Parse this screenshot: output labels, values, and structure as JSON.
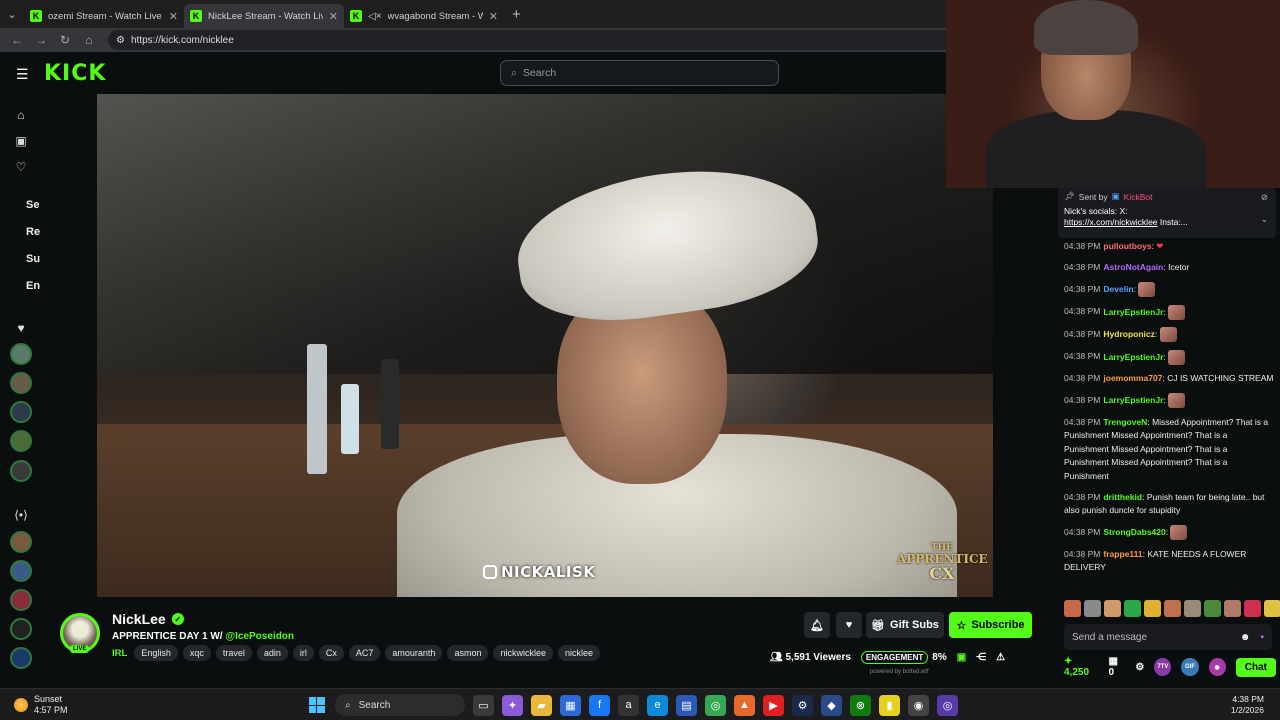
{
  "browser": {
    "tabs": [
      {
        "title": "ozemi Stream - Watch Live on Kick",
        "active": false,
        "muted": false
      },
      {
        "title": "NickLee Stream - Watch Live o",
        "active": true,
        "muted": false
      },
      {
        "title": "wvagabond Stream - Watch L",
        "active": false,
        "muted": true
      }
    ],
    "url": "https://kick.com/nicklee"
  },
  "header": {
    "logo": "KICK",
    "search_placeholder": "Search"
  },
  "rail": {
    "sections": [
      "Se",
      "Re",
      "Su",
      "En"
    ]
  },
  "video": {
    "watermark": "NICKALISK",
    "overlay_line1": "THE",
    "overlay_line2": "APPRENTICE",
    "overlay_line3": "CX"
  },
  "streamer": {
    "name": "NickLee",
    "live_label": "LIVE",
    "title_prefix": "APPRENTICE DAY 1 W/ ",
    "title_mention": "@IcePoseidon",
    "category": "IRL",
    "tags": [
      "English",
      "xqc",
      "travel",
      "adin",
      "irl",
      "Cx",
      "AC7",
      "amouranth",
      "asmon",
      "nickwicklee",
      "nicklee"
    ]
  },
  "actions": {
    "gift_subs": "Gift Subs",
    "subscribe": "Subscribe"
  },
  "stats": {
    "viewers": "5,591 Viewers",
    "engagement_label": "ENGAGEMENT",
    "engagement_value": "8%",
    "powered_by": "powered by botted.wtf"
  },
  "chat": {
    "pinned": {
      "sent_by": "Sent by",
      "bot_name": "KickBot",
      "text": "Nick's socials: X:",
      "url": "https://x.com/nickwicklee",
      "url_suffix": " Insta:..."
    },
    "messages": [
      {
        "time": "04:38 PM",
        "user": "pulloutboys",
        "color": "#ff6b6b",
        "text": "",
        "emotes": 0,
        "heart": true
      },
      {
        "time": "04:38 PM",
        "user": "AstroNotAgain",
        "color": "#b36bff",
        "text": "Icetor",
        "emotes": 0
      },
      {
        "time": "04:38 PM",
        "user": "Develin",
        "color": "#4da3ff",
        "text": "",
        "emotes": 1
      },
      {
        "time": "04:38 PM",
        "user": "LarryEpstienJr",
        "color": "#53fc18",
        "text": "",
        "emotes": 1
      },
      {
        "time": "04:38 PM",
        "user": "Hydroponicz",
        "color": "#f3e03a",
        "text": "",
        "emotes": 1
      },
      {
        "time": "04:38 PM",
        "user": "LarryEpstienJr",
        "color": "#53fc18",
        "text": "",
        "emotes": 1
      },
      {
        "time": "04:38 PM",
        "user": "joemomma707",
        "color": "#ff9a3a",
        "text": "CJ IS WATCHING STREAM",
        "emotes": 0
      },
      {
        "time": "04:38 PM",
        "user": "LarryEpstienJr",
        "color": "#53fc18",
        "text": "",
        "emotes": 1
      },
      {
        "time": "04:38 PM",
        "user": "TrengoveN",
        "color": "#53fc18",
        "text": "Missed Appointment? That is a Punishment Missed Appointment? That is a Punishment Missed Appointment? That is a Punishment Missed Appointment? That is a Punishment",
        "emotes": 0
      },
      {
        "time": "04:38 PM",
        "user": "dritthekid",
        "color": "#53fc18",
        "text": "Punish team for being late.. but also punish duncle for stupidity",
        "emotes": 0
      },
      {
        "time": "04:38 PM",
        "user": "StrongDabs420",
        "color": "#53fc18",
        "text": "",
        "emotes": 1
      },
      {
        "time": "04:38 PM",
        "user": "frappe111",
        "color": "#ff9a3a",
        "text": "KATE NEEDS A FLOWER DELIVERY",
        "emotes": 0
      }
    ],
    "input_placeholder": "Send a message",
    "points": "4,250",
    "count": "0",
    "chat_button": "Chat"
  },
  "taskbar": {
    "weather_label": "Sunset",
    "weather_time": "4:57 PM",
    "search_label": "Search",
    "time": "4:38 PM",
    "date": "1/2/2026"
  }
}
